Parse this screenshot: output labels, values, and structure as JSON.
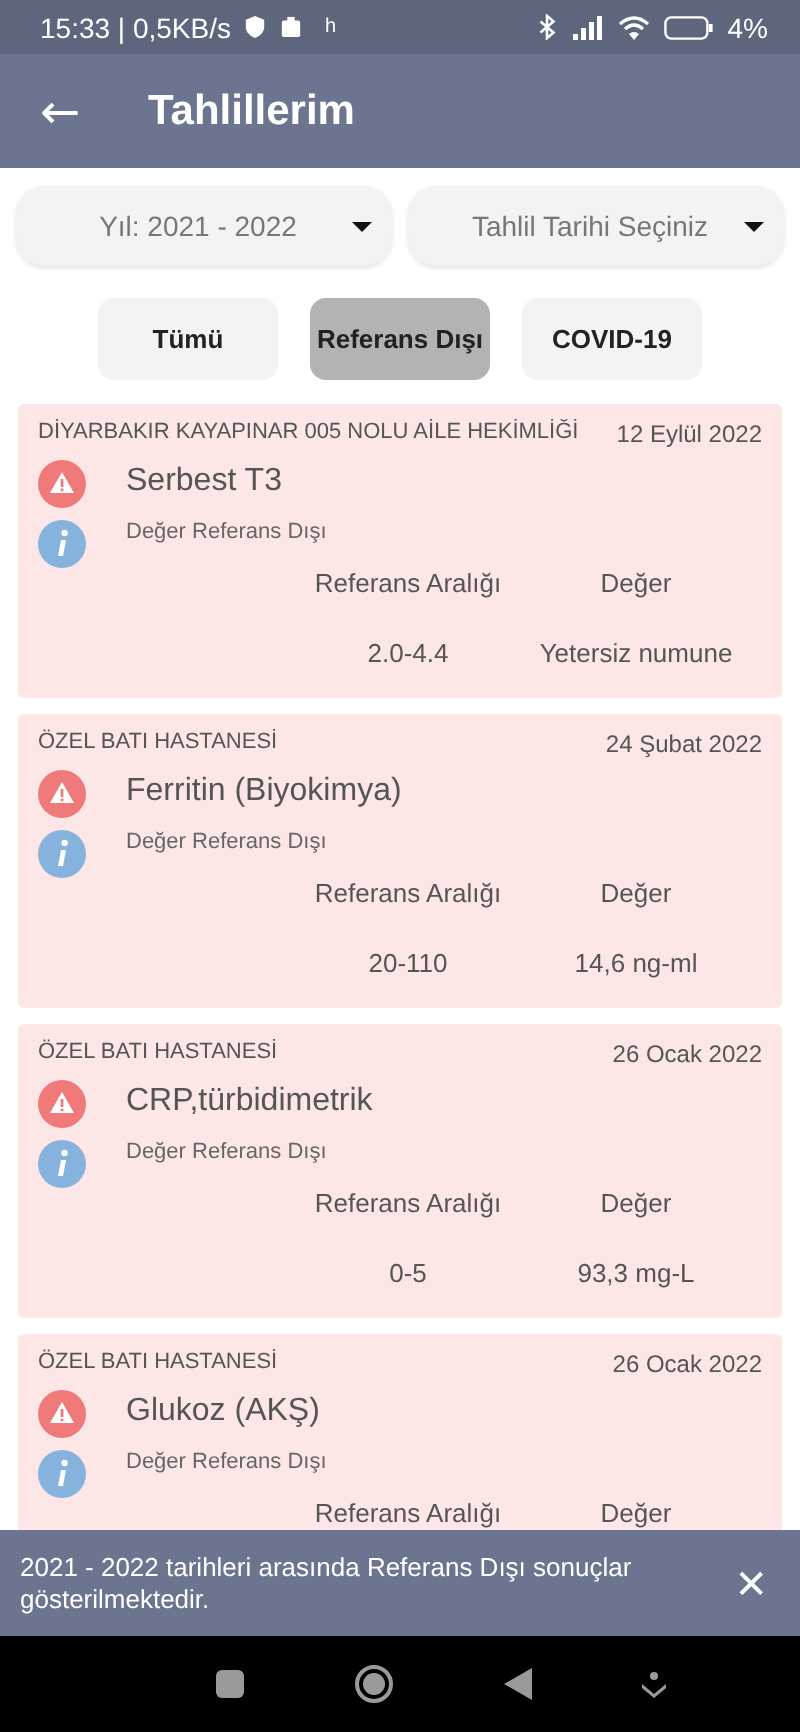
{
  "status_bar": {
    "time": "15:33 | 0,5KB/s",
    "carrier_mark": "h",
    "battery": "4%"
  },
  "app_bar": {
    "back": "←",
    "title": "Tahlillerim"
  },
  "filters": [
    {
      "label": "Yıl: 2021 - 2022"
    },
    {
      "label": "Tahlil Tarihi Seçiniz"
    }
  ],
  "tabs": [
    {
      "label": "Tümü",
      "selected": false
    },
    {
      "label": "Referans Dışı",
      "selected": true
    },
    {
      "label": "COVID-19",
      "selected": false
    }
  ],
  "results": [
    {
      "facility": "DİYARBAKIR KAYAPINAR 005 NOLU AİLE HEKİMLİĞİ",
      "date": "12 Eylül 2022",
      "test": "Serbest T3",
      "status": "Değer Referans Dışı",
      "range_label": "Referans Aralığı",
      "value_label": "Değer",
      "range": "2.0-4.4",
      "value": "Yetersiz numune"
    },
    {
      "facility": "ÖZEL BATI HASTANESİ",
      "date": "24 Şubat 2022",
      "test": "Ferritin (Biyokimya)",
      "status": "Değer Referans Dışı",
      "range_label": "Referans Aralığı",
      "value_label": "Değer",
      "range": "20-110",
      "value": "14,6 ng-ml"
    },
    {
      "facility": "ÖZEL BATI HASTANESİ",
      "date": "26 Ocak 2022",
      "test": "CRP,türbidimetrik",
      "status": "Değer Referans Dışı",
      "range_label": "Referans Aralığı",
      "value_label": "Değer",
      "range": "0-5",
      "value": "93,3 mg-L"
    },
    {
      "facility": "ÖZEL BATI HASTANESİ",
      "date": "26 Ocak 2022",
      "test": "Glukoz (AKŞ)",
      "status": "Değer Referans Dışı",
      "range_label": "Referans Aralığı",
      "value_label": "Değer"
    }
  ],
  "snackbar": {
    "message": "2021 - 2022 tarihleri arasında Referans Dışı sonuçlar gösterilmektedir.",
    "close": "✕"
  }
}
